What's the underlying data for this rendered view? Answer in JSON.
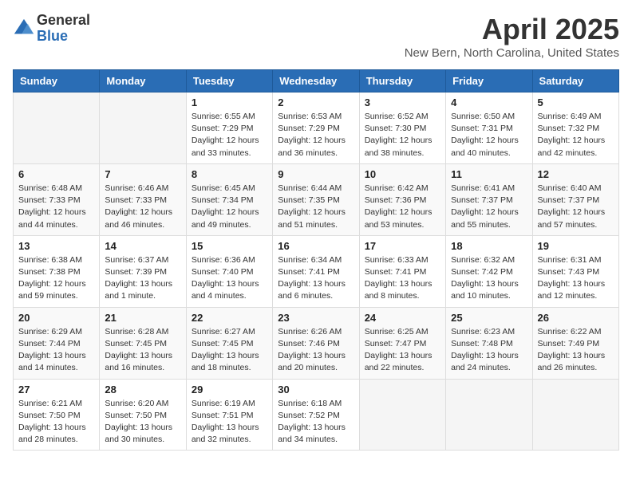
{
  "header": {
    "logo_general": "General",
    "logo_blue": "Blue",
    "title": "April 2025",
    "location": "New Bern, North Carolina, United States"
  },
  "weekdays": [
    "Sunday",
    "Monday",
    "Tuesday",
    "Wednesday",
    "Thursday",
    "Friday",
    "Saturday"
  ],
  "weeks": [
    [
      {
        "day": "",
        "info": ""
      },
      {
        "day": "",
        "info": ""
      },
      {
        "day": "1",
        "info": "Sunrise: 6:55 AM\nSunset: 7:29 PM\nDaylight: 12 hours and 33 minutes."
      },
      {
        "day": "2",
        "info": "Sunrise: 6:53 AM\nSunset: 7:29 PM\nDaylight: 12 hours and 36 minutes."
      },
      {
        "day": "3",
        "info": "Sunrise: 6:52 AM\nSunset: 7:30 PM\nDaylight: 12 hours and 38 minutes."
      },
      {
        "day": "4",
        "info": "Sunrise: 6:50 AM\nSunset: 7:31 PM\nDaylight: 12 hours and 40 minutes."
      },
      {
        "day": "5",
        "info": "Sunrise: 6:49 AM\nSunset: 7:32 PM\nDaylight: 12 hours and 42 minutes."
      }
    ],
    [
      {
        "day": "6",
        "info": "Sunrise: 6:48 AM\nSunset: 7:33 PM\nDaylight: 12 hours and 44 minutes."
      },
      {
        "day": "7",
        "info": "Sunrise: 6:46 AM\nSunset: 7:33 PM\nDaylight: 12 hours and 46 minutes."
      },
      {
        "day": "8",
        "info": "Sunrise: 6:45 AM\nSunset: 7:34 PM\nDaylight: 12 hours and 49 minutes."
      },
      {
        "day": "9",
        "info": "Sunrise: 6:44 AM\nSunset: 7:35 PM\nDaylight: 12 hours and 51 minutes."
      },
      {
        "day": "10",
        "info": "Sunrise: 6:42 AM\nSunset: 7:36 PM\nDaylight: 12 hours and 53 minutes."
      },
      {
        "day": "11",
        "info": "Sunrise: 6:41 AM\nSunset: 7:37 PM\nDaylight: 12 hours and 55 minutes."
      },
      {
        "day": "12",
        "info": "Sunrise: 6:40 AM\nSunset: 7:37 PM\nDaylight: 12 hours and 57 minutes."
      }
    ],
    [
      {
        "day": "13",
        "info": "Sunrise: 6:38 AM\nSunset: 7:38 PM\nDaylight: 12 hours and 59 minutes."
      },
      {
        "day": "14",
        "info": "Sunrise: 6:37 AM\nSunset: 7:39 PM\nDaylight: 13 hours and 1 minute."
      },
      {
        "day": "15",
        "info": "Sunrise: 6:36 AM\nSunset: 7:40 PM\nDaylight: 13 hours and 4 minutes."
      },
      {
        "day": "16",
        "info": "Sunrise: 6:34 AM\nSunset: 7:41 PM\nDaylight: 13 hours and 6 minutes."
      },
      {
        "day": "17",
        "info": "Sunrise: 6:33 AM\nSunset: 7:41 PM\nDaylight: 13 hours and 8 minutes."
      },
      {
        "day": "18",
        "info": "Sunrise: 6:32 AM\nSunset: 7:42 PM\nDaylight: 13 hours and 10 minutes."
      },
      {
        "day": "19",
        "info": "Sunrise: 6:31 AM\nSunset: 7:43 PM\nDaylight: 13 hours and 12 minutes."
      }
    ],
    [
      {
        "day": "20",
        "info": "Sunrise: 6:29 AM\nSunset: 7:44 PM\nDaylight: 13 hours and 14 minutes."
      },
      {
        "day": "21",
        "info": "Sunrise: 6:28 AM\nSunset: 7:45 PM\nDaylight: 13 hours and 16 minutes."
      },
      {
        "day": "22",
        "info": "Sunrise: 6:27 AM\nSunset: 7:45 PM\nDaylight: 13 hours and 18 minutes."
      },
      {
        "day": "23",
        "info": "Sunrise: 6:26 AM\nSunset: 7:46 PM\nDaylight: 13 hours and 20 minutes."
      },
      {
        "day": "24",
        "info": "Sunrise: 6:25 AM\nSunset: 7:47 PM\nDaylight: 13 hours and 22 minutes."
      },
      {
        "day": "25",
        "info": "Sunrise: 6:23 AM\nSunset: 7:48 PM\nDaylight: 13 hours and 24 minutes."
      },
      {
        "day": "26",
        "info": "Sunrise: 6:22 AM\nSunset: 7:49 PM\nDaylight: 13 hours and 26 minutes."
      }
    ],
    [
      {
        "day": "27",
        "info": "Sunrise: 6:21 AM\nSunset: 7:50 PM\nDaylight: 13 hours and 28 minutes."
      },
      {
        "day": "28",
        "info": "Sunrise: 6:20 AM\nSunset: 7:50 PM\nDaylight: 13 hours and 30 minutes."
      },
      {
        "day": "29",
        "info": "Sunrise: 6:19 AM\nSunset: 7:51 PM\nDaylight: 13 hours and 32 minutes."
      },
      {
        "day": "30",
        "info": "Sunrise: 6:18 AM\nSunset: 7:52 PM\nDaylight: 13 hours and 34 minutes."
      },
      {
        "day": "",
        "info": ""
      },
      {
        "day": "",
        "info": ""
      },
      {
        "day": "",
        "info": ""
      }
    ]
  ]
}
